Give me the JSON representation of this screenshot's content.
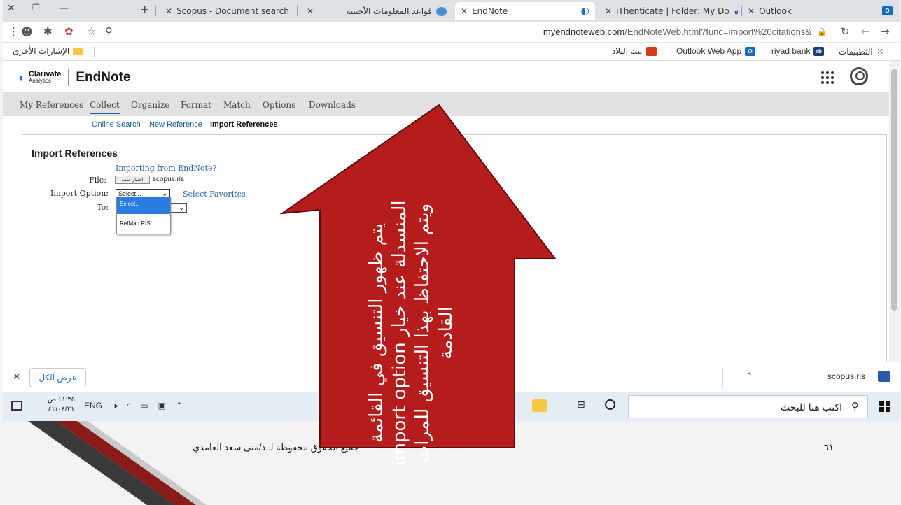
{
  "tabs": [
    {
      "label": "Outlook",
      "favicon": "outlook-favicon"
    },
    {
      "label": "iThenticate | Folder: My Do",
      "favicon": "checkmark-favicon"
    },
    {
      "label": "EndNote",
      "favicon": "clarivate-favicon",
      "active": true
    },
    {
      "label": "قواعد المعلومات الأجنبية",
      "favicon": "globe-favicon"
    },
    {
      "label": "Scopus - Document search",
      "favicon": "scopus-favicon",
      "favicon_text": "SC"
    }
  ],
  "address": {
    "url_host": "myendnoteweb.com",
    "url_path": "/EndNoteWeb.html?func=import%20citations&"
  },
  "bookmarks": {
    "other": "الإشارات الأخرى",
    "items": [
      "التطبيقات",
      "riyad bank",
      "Outlook Web App",
      "بنك البلاد"
    ]
  },
  "app": {
    "company": "Clarivate",
    "company_sub": "Analytics",
    "brand": "EndNote",
    "menu": [
      "My References",
      "Collect",
      "Organize",
      "Format",
      "Match",
      "Options",
      "Downloads"
    ],
    "submenu": [
      "Online Search",
      "New Reference",
      "Import References"
    ],
    "panel": {
      "title": "Import References",
      "importing_link": "Importing from EndNote?",
      "file_label": "File:",
      "file_button": "اختيار ملف",
      "file_name": "scopus.ris",
      "import_option_label": "Import Option:",
      "import_option_value": "Select...",
      "select_favorites": "Select Favorites",
      "to_label": "To:",
      "dropdown_options": [
        "Select...",
        "RefMan RIS"
      ]
    }
  },
  "downloads": {
    "show_all": "عرض الكل",
    "file": "scopus.ris"
  },
  "taskbar": {
    "search_placeholder": "اكتب هنا للبحث",
    "time": "١١:٣٥ ص",
    "date": "٤٢/٠٤/٢١",
    "lang": "ENG"
  },
  "slide": {
    "footer": "جميع الحقوق محفوظة لـ د/منى سعد الغامدي",
    "page_number": "٦١",
    "caption": "يتم ظهور التنسيق في القائمة المنسدلة عند خيار import option\nويتم الاحتفاظ بهذا التنسيق للمرات القادمة"
  },
  "colors": {
    "arrow": "#b71c1c",
    "accent_link": "#2a63a8",
    "selection": "#2a7ce0"
  }
}
